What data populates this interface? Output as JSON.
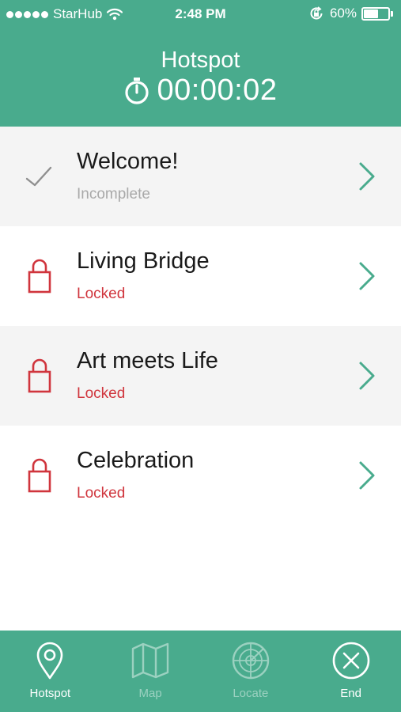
{
  "status_bar": {
    "carrier": "StarHub",
    "time": "2:48 PM",
    "battery": "60%",
    "battery_level": 0.6
  },
  "header": {
    "title": "Hotspot",
    "timer": "00:00:02"
  },
  "colors": {
    "accent": "#49ab8d",
    "locked": "#d0353d",
    "incomplete": "#a9a9a9",
    "alt_row": "#f4f4f4"
  },
  "items": [
    {
      "title": "Welcome!",
      "status": "Incomplete",
      "icon": "check-icon"
    },
    {
      "title": "Living Bridge",
      "status": "Locked",
      "icon": "lock-icon"
    },
    {
      "title": "Art meets Life",
      "status": "Locked",
      "icon": "lock-icon"
    },
    {
      "title": "Celebration",
      "status": "Locked",
      "icon": "lock-icon"
    }
  ],
  "tabs": [
    {
      "label": "Hotspot",
      "icon": "location-pin-icon",
      "active": true
    },
    {
      "label": "Map",
      "icon": "map-icon",
      "active": false
    },
    {
      "label": "Locate",
      "icon": "radar-icon",
      "active": false
    },
    {
      "label": "End",
      "icon": "close-circle-icon",
      "active": false
    }
  ]
}
